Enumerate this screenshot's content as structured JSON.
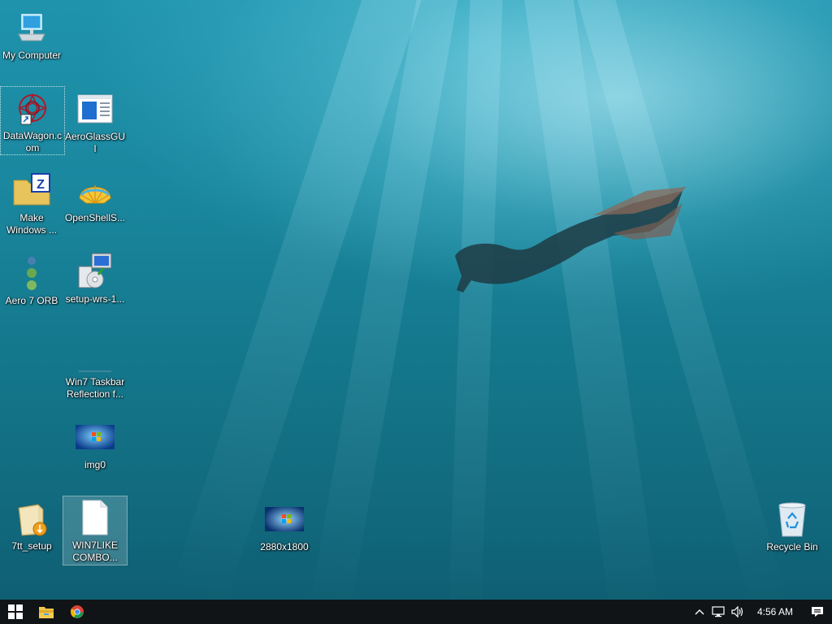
{
  "desktop": {
    "icons": [
      {
        "label": "My Computer",
        "icon": "computer-icon"
      },
      {
        "label": "DataWagon.com",
        "icon": "shortcut-web-icon"
      },
      {
        "label": "AeroGlassGUI",
        "icon": "window-app-icon"
      },
      {
        "label": "Make Windows ...",
        "icon": "zip-folder-icon"
      },
      {
        "label": "OpenShellS...",
        "icon": "shell-icon"
      },
      {
        "label": "Aero 7 ORB",
        "icon": "orb-strip-icon"
      },
      {
        "label": "setup-wrs-1...",
        "icon": "installer-icon"
      },
      {
        "label": "Win7 Taskbar Reflection f...",
        "icon": "blank-icon"
      },
      {
        "label": "img0",
        "icon": "image-thumbnail-icon"
      },
      {
        "label": "7tt_setup",
        "icon": "setup-box-icon"
      },
      {
        "label": "WIN7LIKE COMBO...",
        "icon": "document-icon"
      },
      {
        "label": "2880x1800",
        "icon": "image-thumbnail-icon"
      },
      {
        "label": "Recycle Bin",
        "icon": "recycle-bin-icon"
      }
    ]
  },
  "taskbar": {
    "start": "windows-start-icon",
    "pinned": [
      "file-explorer-icon",
      "chrome-icon"
    ],
    "tray": {
      "clock": "4:56 AM",
      "icons": [
        "chevron-up-icon",
        "network-icon",
        "volume-icon",
        "action-center-icon"
      ]
    }
  },
  "colors": {
    "taskbar": "#101417",
    "water_top": "#1f93ad",
    "water_bottom": "#0f5f73"
  }
}
